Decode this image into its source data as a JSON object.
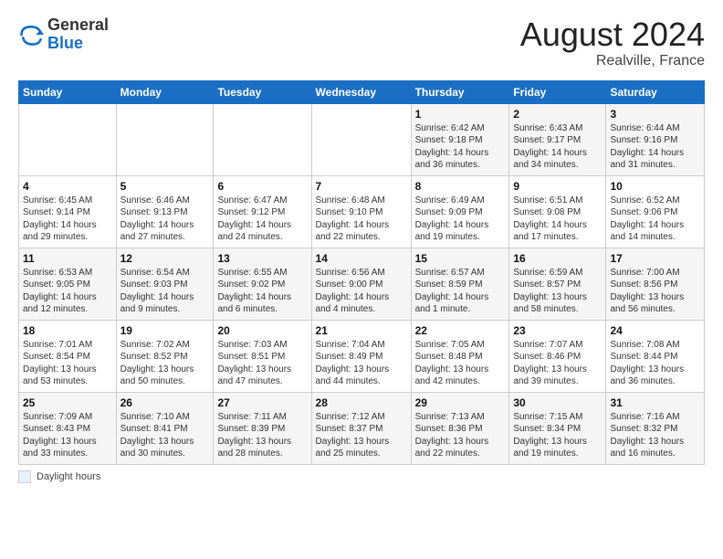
{
  "header": {
    "logo_general": "General",
    "logo_blue": "Blue",
    "month_title": "August 2024",
    "location": "Realville, France"
  },
  "footer": {
    "label": "Daylight hours"
  },
  "weekdays": [
    "Sunday",
    "Monday",
    "Tuesday",
    "Wednesday",
    "Thursday",
    "Friday",
    "Saturday"
  ],
  "weeks": [
    [
      {
        "day": "",
        "info": ""
      },
      {
        "day": "",
        "info": ""
      },
      {
        "day": "",
        "info": ""
      },
      {
        "day": "",
        "info": ""
      },
      {
        "day": "1",
        "info": "Sunrise: 6:42 AM\nSunset: 9:18 PM\nDaylight: 14 hours\nand 36 minutes."
      },
      {
        "day": "2",
        "info": "Sunrise: 6:43 AM\nSunset: 9:17 PM\nDaylight: 14 hours\nand 34 minutes."
      },
      {
        "day": "3",
        "info": "Sunrise: 6:44 AM\nSunset: 9:16 PM\nDaylight: 14 hours\nand 31 minutes."
      }
    ],
    [
      {
        "day": "4",
        "info": "Sunrise: 6:45 AM\nSunset: 9:14 PM\nDaylight: 14 hours\nand 29 minutes."
      },
      {
        "day": "5",
        "info": "Sunrise: 6:46 AM\nSunset: 9:13 PM\nDaylight: 14 hours\nand 27 minutes."
      },
      {
        "day": "6",
        "info": "Sunrise: 6:47 AM\nSunset: 9:12 PM\nDaylight: 14 hours\nand 24 minutes."
      },
      {
        "day": "7",
        "info": "Sunrise: 6:48 AM\nSunset: 9:10 PM\nDaylight: 14 hours\nand 22 minutes."
      },
      {
        "day": "8",
        "info": "Sunrise: 6:49 AM\nSunset: 9:09 PM\nDaylight: 14 hours\nand 19 minutes."
      },
      {
        "day": "9",
        "info": "Sunrise: 6:51 AM\nSunset: 9:08 PM\nDaylight: 14 hours\nand 17 minutes."
      },
      {
        "day": "10",
        "info": "Sunrise: 6:52 AM\nSunset: 9:06 PM\nDaylight: 14 hours\nand 14 minutes."
      }
    ],
    [
      {
        "day": "11",
        "info": "Sunrise: 6:53 AM\nSunset: 9:05 PM\nDaylight: 14 hours\nand 12 minutes."
      },
      {
        "day": "12",
        "info": "Sunrise: 6:54 AM\nSunset: 9:03 PM\nDaylight: 14 hours\nand 9 minutes."
      },
      {
        "day": "13",
        "info": "Sunrise: 6:55 AM\nSunset: 9:02 PM\nDaylight: 14 hours\nand 6 minutes."
      },
      {
        "day": "14",
        "info": "Sunrise: 6:56 AM\nSunset: 9:00 PM\nDaylight: 14 hours\nand 4 minutes."
      },
      {
        "day": "15",
        "info": "Sunrise: 6:57 AM\nSunset: 8:59 PM\nDaylight: 14 hours\nand 1 minute."
      },
      {
        "day": "16",
        "info": "Sunrise: 6:59 AM\nSunset: 8:57 PM\nDaylight: 13 hours\nand 58 minutes."
      },
      {
        "day": "17",
        "info": "Sunrise: 7:00 AM\nSunset: 8:56 PM\nDaylight: 13 hours\nand 56 minutes."
      }
    ],
    [
      {
        "day": "18",
        "info": "Sunrise: 7:01 AM\nSunset: 8:54 PM\nDaylight: 13 hours\nand 53 minutes."
      },
      {
        "day": "19",
        "info": "Sunrise: 7:02 AM\nSunset: 8:52 PM\nDaylight: 13 hours\nand 50 minutes."
      },
      {
        "day": "20",
        "info": "Sunrise: 7:03 AM\nSunset: 8:51 PM\nDaylight: 13 hours\nand 47 minutes."
      },
      {
        "day": "21",
        "info": "Sunrise: 7:04 AM\nSunset: 8:49 PM\nDaylight: 13 hours\nand 44 minutes."
      },
      {
        "day": "22",
        "info": "Sunrise: 7:05 AM\nSunset: 8:48 PM\nDaylight: 13 hours\nand 42 minutes."
      },
      {
        "day": "23",
        "info": "Sunrise: 7:07 AM\nSunset: 8:46 PM\nDaylight: 13 hours\nand 39 minutes."
      },
      {
        "day": "24",
        "info": "Sunrise: 7:08 AM\nSunset: 8:44 PM\nDaylight: 13 hours\nand 36 minutes."
      }
    ],
    [
      {
        "day": "25",
        "info": "Sunrise: 7:09 AM\nSunset: 8:43 PM\nDaylight: 13 hours\nand 33 minutes."
      },
      {
        "day": "26",
        "info": "Sunrise: 7:10 AM\nSunset: 8:41 PM\nDaylight: 13 hours\nand 30 minutes."
      },
      {
        "day": "27",
        "info": "Sunrise: 7:11 AM\nSunset: 8:39 PM\nDaylight: 13 hours\nand 28 minutes."
      },
      {
        "day": "28",
        "info": "Sunrise: 7:12 AM\nSunset: 8:37 PM\nDaylight: 13 hours\nand 25 minutes."
      },
      {
        "day": "29",
        "info": "Sunrise: 7:13 AM\nSunset: 8:36 PM\nDaylight: 13 hours\nand 22 minutes."
      },
      {
        "day": "30",
        "info": "Sunrise: 7:15 AM\nSunset: 8:34 PM\nDaylight: 13 hours\nand 19 minutes."
      },
      {
        "day": "31",
        "info": "Sunrise: 7:16 AM\nSunset: 8:32 PM\nDaylight: 13 hours\nand 16 minutes."
      }
    ]
  ]
}
